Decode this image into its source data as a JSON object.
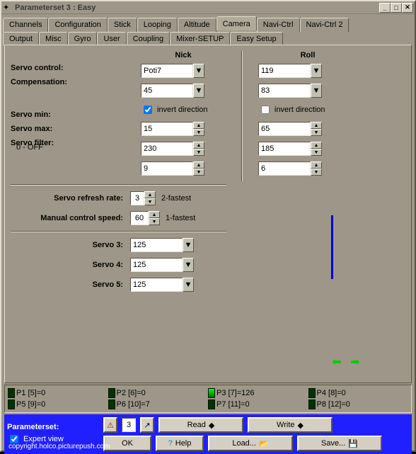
{
  "window": {
    "title": "Parameterset 3 : Easy"
  },
  "tabs_row1": [
    "Channels",
    "Configuration",
    "Stick",
    "Looping",
    "Altitude",
    "Camera",
    "Navi-Ctrl",
    "Navi-Ctrl 2"
  ],
  "tabs_row2": [
    "Output",
    "Misc",
    "Gyro",
    "User",
    "Coupling",
    "Mixer-SETUP",
    "Easy Setup"
  ],
  "active_tab": "Camera",
  "headers": {
    "nick": "Nick",
    "roll": "Roll"
  },
  "labels": {
    "servo_control": "Servo control:",
    "compensation": "Compensation:",
    "invert_direction": "invert direction",
    "servo_min": "Servo min:",
    "servo_max": "Servo max:",
    "servo_filter": "Servo filter:",
    "filter_sub": "0 - OFF",
    "servo_refresh": "Servo refresh rate:",
    "refresh_hint": "2-fastest",
    "manual_speed": "Manual control speed:",
    "manual_hint": "1-fastest",
    "servo3": "Servo 3:",
    "servo4": "Servo 4:",
    "servo5": "Servo 5:"
  },
  "nick": {
    "servo_control": "Poti7",
    "compensation": "45",
    "invert": true,
    "servo_min": "15",
    "servo_max": "230",
    "servo_filter": "9"
  },
  "roll": {
    "servo_control": "119",
    "compensation": "83",
    "invert": false,
    "servo_min": "65",
    "servo_max": "185",
    "servo_filter": "6"
  },
  "refresh_rate": "3",
  "manual_speed": "60",
  "servo3": "125",
  "servo4": "125",
  "servo5": "125",
  "pstats": [
    "P1 [5]=0",
    "P2 [6]=0",
    "P3 [7]=126",
    "P4 [8]=0",
    "P5 [9]=0",
    "P6 [10]=7",
    "P7 [11]=0",
    "P8 [12]=0"
  ],
  "bottom": {
    "paramset_label": "Parameterset:",
    "expert_view": "Expert view",
    "set_num": "3",
    "read": "Read",
    "write": "Write",
    "ok": "OK",
    "help": "Help",
    "load": "Load...",
    "save": "Save..."
  },
  "watermark": "copyright.holco.picturepush.com"
}
